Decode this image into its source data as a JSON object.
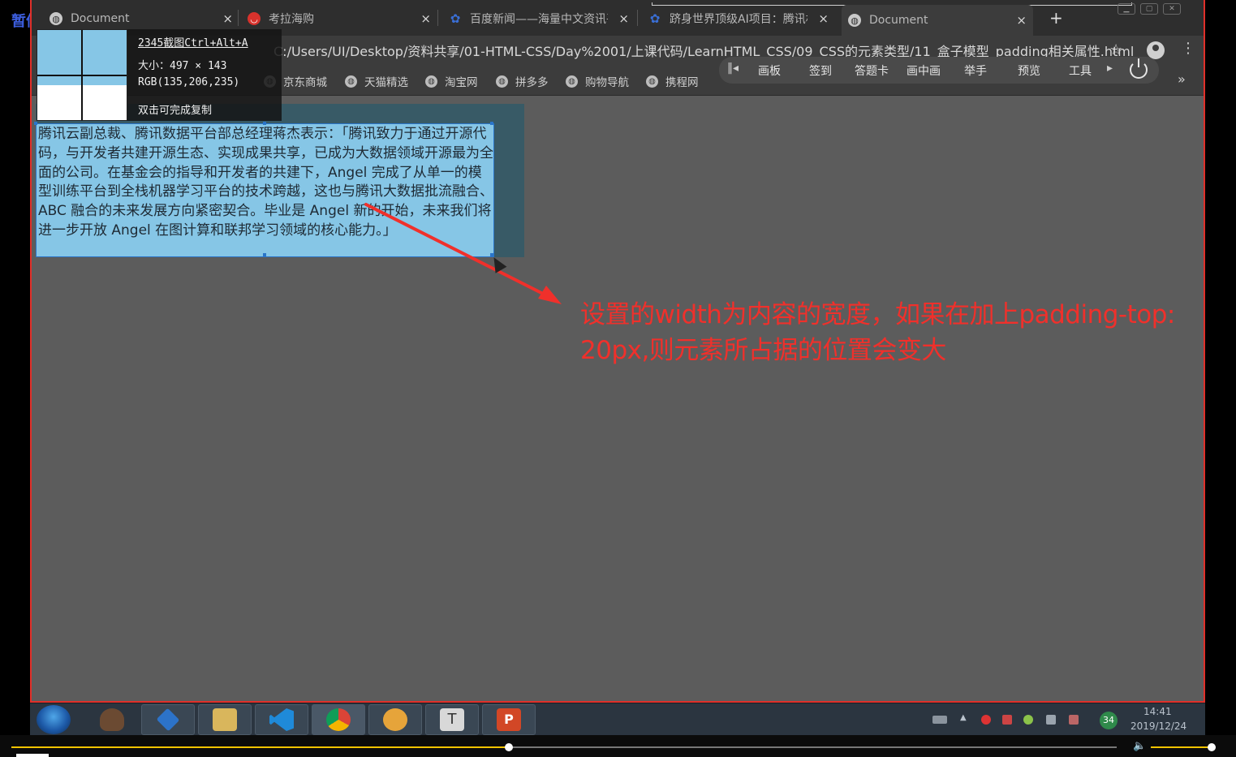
{
  "overlay": {
    "pause_label": "暂停"
  },
  "browser": {
    "tabs": [
      {
        "title": "Document",
        "icon": "globe-icon",
        "close": "×",
        "active": false
      },
      {
        "title": "考拉海购",
        "icon": "kaola-icon",
        "close": "×",
        "active": false
      },
      {
        "title": "百度新闻——海量中文资讯平",
        "icon": "baidu-icon",
        "close": "×",
        "active": false
      },
      {
        "title": "跻身世界顶级AI项目：腾讯机",
        "icon": "baidu-icon",
        "close": "×",
        "active": false
      },
      {
        "title": "Document",
        "icon": "globe-icon",
        "close": "×",
        "active": true
      }
    ],
    "new_tab": "+",
    "address": "C:/Users/UI/Desktop/资料共享/01-HTML-CSS/Day%2001/上课代码/LearnHTML_CSS/09_CSS的元素类型/11_盒子模型_padding相关属性.html",
    "bookmarks": [
      "京东商城",
      "天猫精选",
      "淘宝网",
      "拼多多",
      "购物导航",
      "携程网"
    ],
    "bookmarks_more": "»"
  },
  "annotation_toolbar": {
    "left_glyph": "‖◂",
    "items": [
      "画板",
      "签到",
      "答题卡",
      "画中画",
      "举手",
      "预览",
      "工具"
    ],
    "right_glyph": "▸"
  },
  "screenshot_tool": {
    "title": "2345截图Ctrl+Alt+A",
    "size": "大小：497 × 143",
    "rgb": "RGB(135,206,235)",
    "hint": "双击可完成复制"
  },
  "page": {
    "paragraph": "腾讯云副总裁、腾讯数据平台部总经理蒋杰表示：「腾讯致力于通过开源代码，与开发者共建开源生态、实现成果共享，已成为大数据领域开源最为全面的公司。在基金会的指导和开发者的共建下，Angel 完成了从单一的模型训练平台到全栈机器学习平台的技术跨越，这也与腾讯大数据批流融合、ABC 融合的未来发展方向紧密契合。毕业是 Angel 新的开始，未来我们将进一步开放 Angel 在图计算和联邦学习领域的核心能力。」",
    "note": "设置的width为内容的宽度，如果在加上padding-top: 20px,则元素所占据的位置会变大"
  },
  "taskbar": {
    "tray_badge": "34",
    "time": "14:41",
    "date": "2019/12/24"
  },
  "player": {
    "progress": 0.45,
    "volume": 0.94
  },
  "colors": {
    "content_box": "#86c6e6",
    "padding_box": "#385a66",
    "annotation": "#f0302b",
    "frame_border": "#e0302a",
    "player_accent": "#f2c400"
  }
}
